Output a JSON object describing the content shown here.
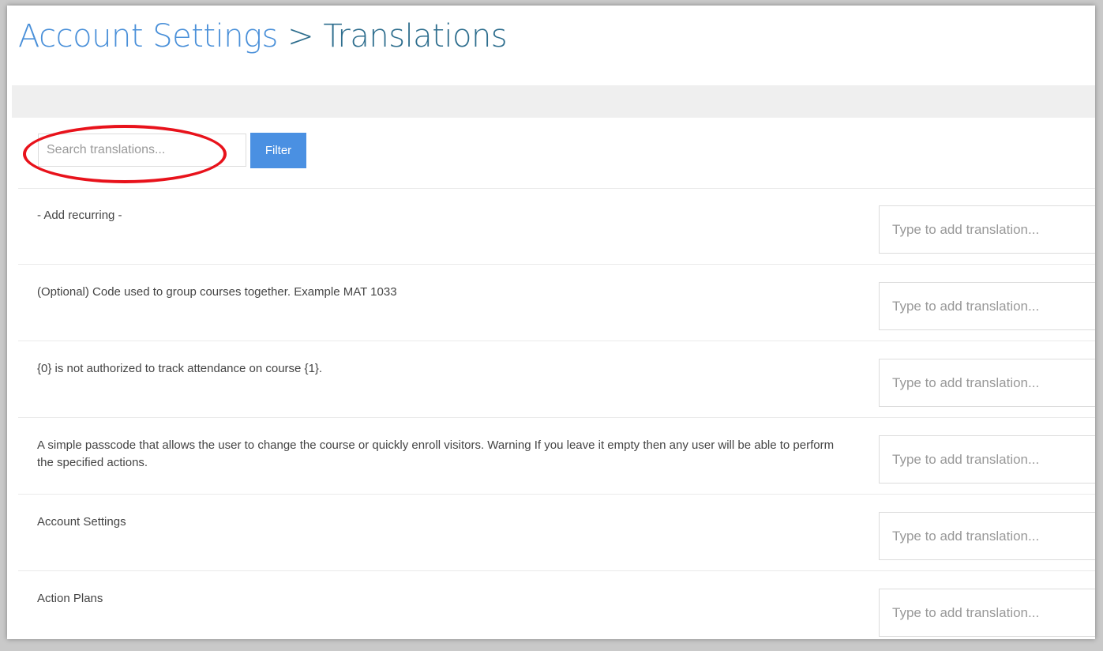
{
  "header": {
    "breadcrumb_parent": "Account Settings",
    "separator": ">",
    "title": "Translations"
  },
  "search": {
    "placeholder": "Search translations...",
    "value": "",
    "filter_label": "Filter"
  },
  "rows": [
    {
      "label": "- Add recurring -",
      "placeholder": "Type to add translation..."
    },
    {
      "label": "(Optional) Code used to group courses together. Example MAT 1033",
      "placeholder": "Type to add translation..."
    },
    {
      "label": "{0} is not authorized to track attendance on course {1}.",
      "placeholder": "Type to add translation..."
    },
    {
      "label": "A simple passcode that allows the user to change the course or quickly enroll visitors. Warning If you leave it empty then any user will be able to perform the specified actions.",
      "placeholder": "Type to add translation..."
    },
    {
      "label": "Account Settings",
      "placeholder": "Type to add translation..."
    },
    {
      "label": "Action Plans",
      "placeholder": "Type to add translation..."
    }
  ],
  "colors": {
    "link": "#4a90d9",
    "title": "#2e6e8e",
    "button": "#4a90e2",
    "highlight": "#e8121b"
  }
}
